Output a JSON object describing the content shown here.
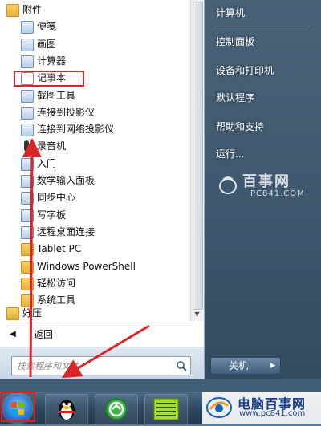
{
  "start_menu": {
    "programs": [
      {
        "label": "附件",
        "icon": "folder-icon",
        "level": 0
      },
      {
        "label": "便笺",
        "icon": "sticky-notes-icon",
        "level": 1
      },
      {
        "label": "画图",
        "icon": "paint-icon",
        "level": 1
      },
      {
        "label": "计算器",
        "icon": "calculator-icon",
        "level": 1
      },
      {
        "label": "记事本",
        "icon": "notepad-icon",
        "level": 1
      },
      {
        "label": "截图工具",
        "icon": "snipping-tool-icon",
        "level": 1
      },
      {
        "label": "连接到投影仪",
        "icon": "projector-icon",
        "level": 1
      },
      {
        "label": "连接到网络投影仪",
        "icon": "network-projector-icon",
        "level": 1
      },
      {
        "label": "录音机",
        "icon": "microphone-icon",
        "level": 1
      },
      {
        "label": "入门",
        "icon": "getting-started-icon",
        "level": 1
      },
      {
        "label": "数学输入面板",
        "icon": "math-input-icon",
        "level": 1
      },
      {
        "label": "同步中心",
        "icon": "sync-center-icon",
        "level": 1
      },
      {
        "label": "写字板",
        "icon": "wordpad-icon",
        "level": 1
      },
      {
        "label": "远程桌面连接",
        "icon": "remote-desktop-icon",
        "level": 1
      },
      {
        "label": "Tablet PC",
        "icon": "folder-icon",
        "level": 1
      },
      {
        "label": "Windows PowerShell",
        "icon": "folder-icon",
        "level": 1
      },
      {
        "label": "轻松访问",
        "icon": "folder-icon",
        "level": 1
      },
      {
        "label": "系统工具",
        "icon": "folder-icon",
        "level": 1
      },
      {
        "label": "好压",
        "icon": "folder-icon",
        "level": 0
      }
    ],
    "back_label": "返回",
    "search_placeholder": "搜索程序和文件",
    "right_items": [
      "计算机",
      "控制面板",
      "设备和打印机",
      "默认程序",
      "帮助和支持",
      "运行..."
    ],
    "shutdown_label": "关机"
  },
  "watermark": {
    "title": "百事网",
    "subtitle": "PC841.COM"
  },
  "brand": {
    "name": "电脑百事网",
    "url": "www.pc841.com"
  },
  "colors": {
    "highlight": "#d9262a",
    "folder": "#e5b236",
    "taskbar": "#2d4860"
  }
}
